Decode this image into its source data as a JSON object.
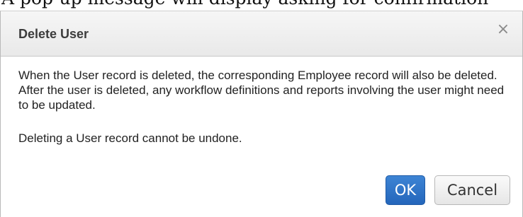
{
  "background_text": "A pop-up message will display asking for confirmation",
  "dialog": {
    "title": "Delete User",
    "close_glyph": "×",
    "message_primary": "When the User record is deleted, the corresponding Employee record will also be deleted. After the user is deleted, any workflow definitions and reports involving the user might need to be updated.",
    "message_secondary": "Deleting a User record cannot be undone.",
    "ok_label": "OK",
    "cancel_label": "Cancel"
  },
  "colors": {
    "ok_button": "#2a6fc4",
    "header_background": "#efefef",
    "body_text": "#222222"
  },
  "icons": {
    "close": "close-icon"
  }
}
